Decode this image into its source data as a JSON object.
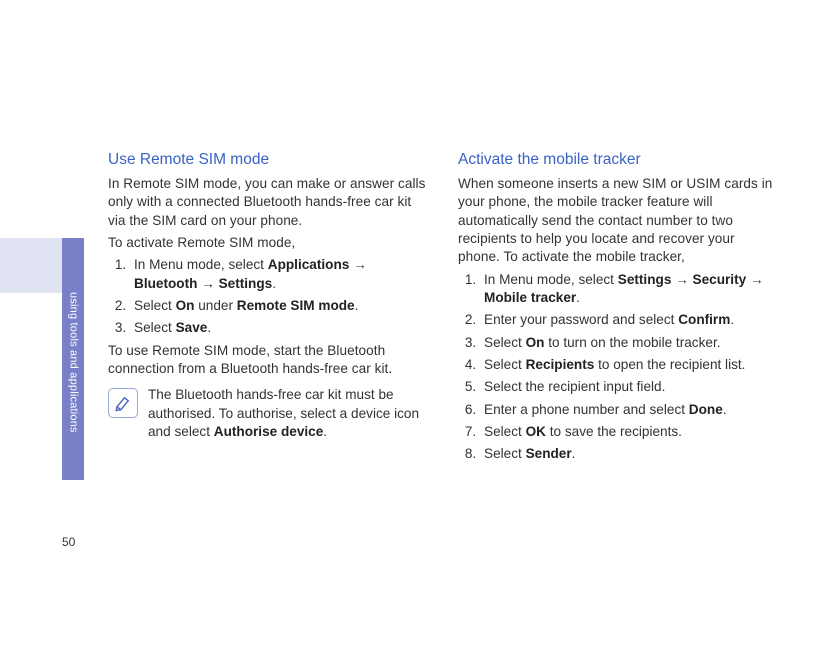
{
  "page_number": "50",
  "sidebar_label": "using tools and applications",
  "left": {
    "heading": "Use Remote SIM mode",
    "intro": "In Remote SIM mode, you can make or answer calls only with a connected Bluetooth hands-free car kit via the SIM card on your phone.",
    "pre_steps": "To activate Remote SIM mode,",
    "step1_a": "In Menu mode, select ",
    "step1_b": "Applications",
    "step1_arrow1": " → ",
    "step1_c": "Bluetooth",
    "step1_arrow2": " → ",
    "step1_d": "Settings",
    "step1_e": ".",
    "step2_a": "Select ",
    "step2_b": "On",
    "step2_c": " under ",
    "step2_d": "Remote SIM mode",
    "step2_e": ".",
    "step3_a": "Select ",
    "step3_b": "Save",
    "step3_c": ".",
    "post_steps": "To use Remote SIM mode, start the Bluetooth connection from a Bluetooth hands-free car kit.",
    "note_a": "The Bluetooth hands-free car kit must be authorised. To authorise, select a device icon and select ",
    "note_b": "Authorise device",
    "note_c": "."
  },
  "right": {
    "heading": "Activate the mobile tracker",
    "intro": "When someone inserts a new SIM or USIM cards in your phone, the mobile tracker feature will automatically send the contact number to two recipients to help you locate and recover your phone. To activate the mobile tracker,",
    "s1_a": "In Menu mode, select ",
    "s1_b": "Settings",
    "s1_ar1": " → ",
    "s1_c": "Security",
    "s1_ar2": " → ",
    "s1_d": "Mobile tracker",
    "s1_e": ".",
    "s2_a": "Enter your password and select ",
    "s2_b": "Confirm",
    "s2_c": ".",
    "s3_a": "Select ",
    "s3_b": "On",
    "s3_c": " to turn on the mobile tracker.",
    "s4_a": "Select ",
    "s4_b": "Recipients",
    "s4_c": " to open the recipient list.",
    "s5": "Select the recipient input field.",
    "s6_a": "Enter a phone number and select ",
    "s6_b": "Done",
    "s6_c": ".",
    "s7_a": "Select ",
    "s7_b": "OK",
    "s7_c": " to save the recipients.",
    "s8_a": "Select ",
    "s8_b": "Sender",
    "s8_c": "."
  }
}
